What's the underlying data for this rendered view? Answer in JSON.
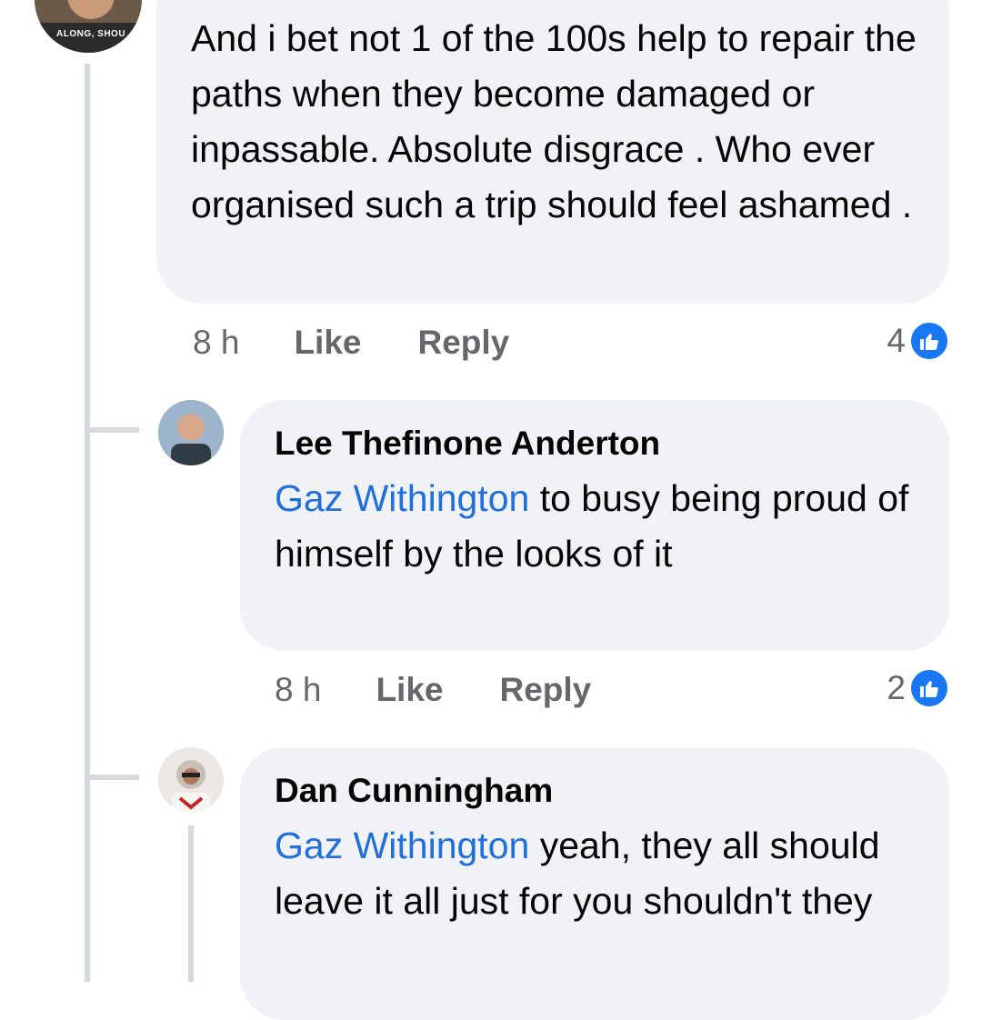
{
  "comments": [
    {
      "text": "And i bet not 1 of the 100s help to repair the paths when they become damaged or inpassable. Absolute disgrace . Who ever organised such a trip should feel ashamed  .",
      "time": "8 h",
      "like_label": "Like",
      "reply_label": "Reply",
      "reaction_count": "4",
      "avatar_badge_text": "ALONG, SHOU"
    },
    {
      "author": "Lee Thefinone Anderton",
      "mention": "Gaz Withington",
      "text": " to busy being proud of himself by the looks of it",
      "time": "8 h",
      "like_label": "Like",
      "reply_label": "Reply",
      "reaction_count": "2"
    },
    {
      "author": "Dan Cunningham",
      "mention": "Gaz Withington",
      "text": " yeah, they all should leave it all just for you shouldn't they"
    }
  ],
  "colors": {
    "bubble": "#f0f2f5",
    "mention": "#216fdb",
    "meta": "#65676b",
    "like_badge": "#1877f2"
  }
}
